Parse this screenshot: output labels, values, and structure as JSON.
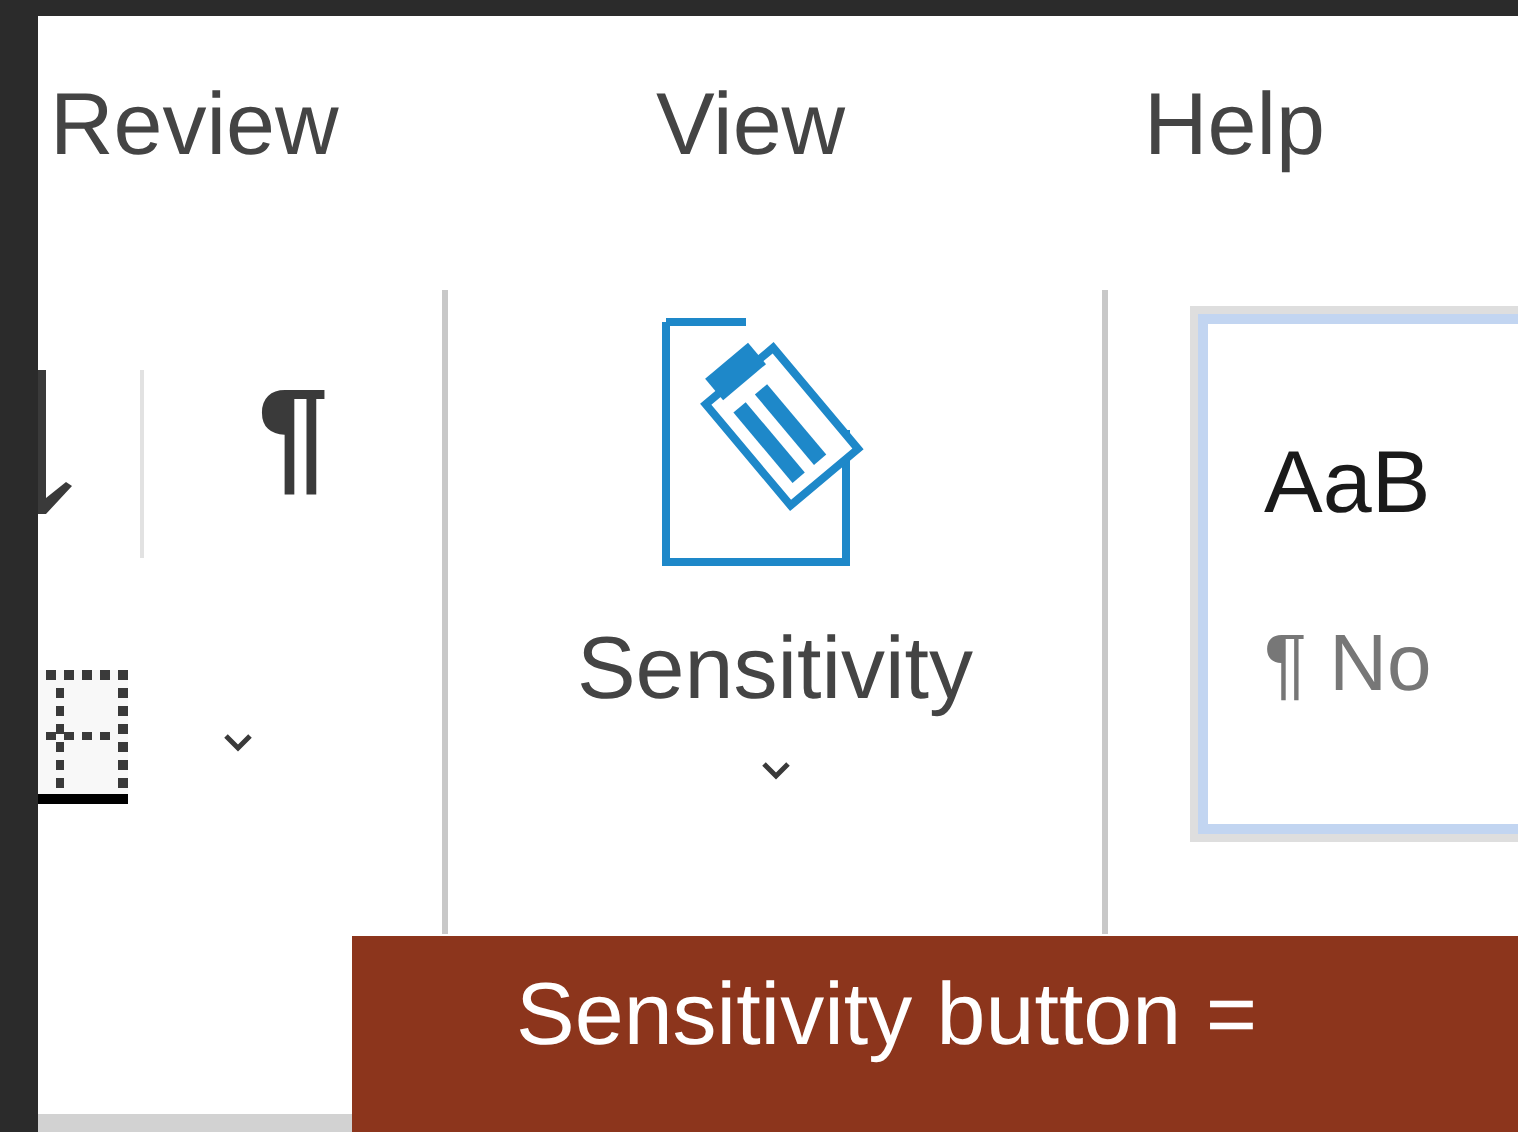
{
  "tabs": [
    {
      "label": "Review"
    },
    {
      "label": "View"
    },
    {
      "label": "Help"
    }
  ],
  "ribbon": {
    "paragraph_mark": "¶",
    "sensitivity": {
      "label": "Sensitivity"
    },
    "style_gallery": [
      {
        "preview": "AaB",
        "name": "¶ No",
        "selected": true
      }
    ]
  },
  "callout": {
    "text": "Sensitivity button ="
  }
}
